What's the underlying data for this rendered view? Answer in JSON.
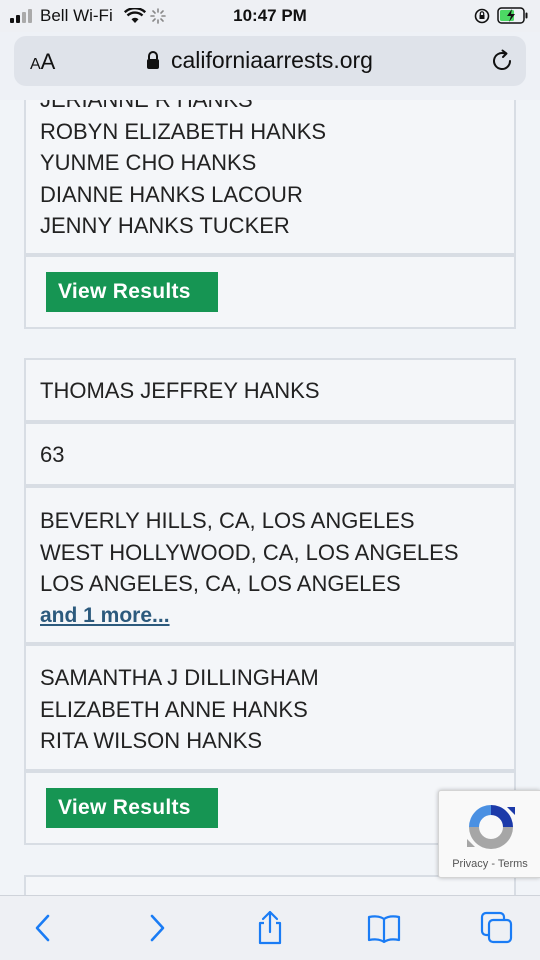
{
  "status_bar": {
    "carrier": "Bell Wi-Fi",
    "time": "10:47 PM"
  },
  "browser": {
    "text_size_label_small": "A",
    "text_size_label_large": "A",
    "url": "californiaarrests.org"
  },
  "records": [
    {
      "names_partial": "JERIANNE R HANKS",
      "names": [
        "ROBYN ELIZABETH HANKS",
        "YUNME CHO HANKS",
        "DIANNE HANKS LACOUR",
        "JENNY HANKS TUCKER"
      ],
      "button_label": "View Results"
    },
    {
      "full_name": "THOMAS JEFFREY HANKS",
      "age": "63",
      "locations": [
        "BEVERLY HILLS, CA, LOS ANGELES",
        "WEST HOLLYWOOD, CA, LOS ANGELES",
        "LOS ANGELES, CA, LOS ANGELES"
      ],
      "more_link": "and 1 more...",
      "relatives": [
        "SAMANTHA J DILLINGHAM",
        "ELIZABETH ANNE HANKS",
        "RITA WILSON HANKS"
      ],
      "button_label": "View Results"
    }
  ],
  "recaptcha": {
    "privacy": "Privacy",
    "separator": " - ",
    "terms": "Terms"
  },
  "colors": {
    "button_green": "#169553",
    "link_blue": "#2c5a7d",
    "toolbar_blue": "#1a7cf5"
  }
}
